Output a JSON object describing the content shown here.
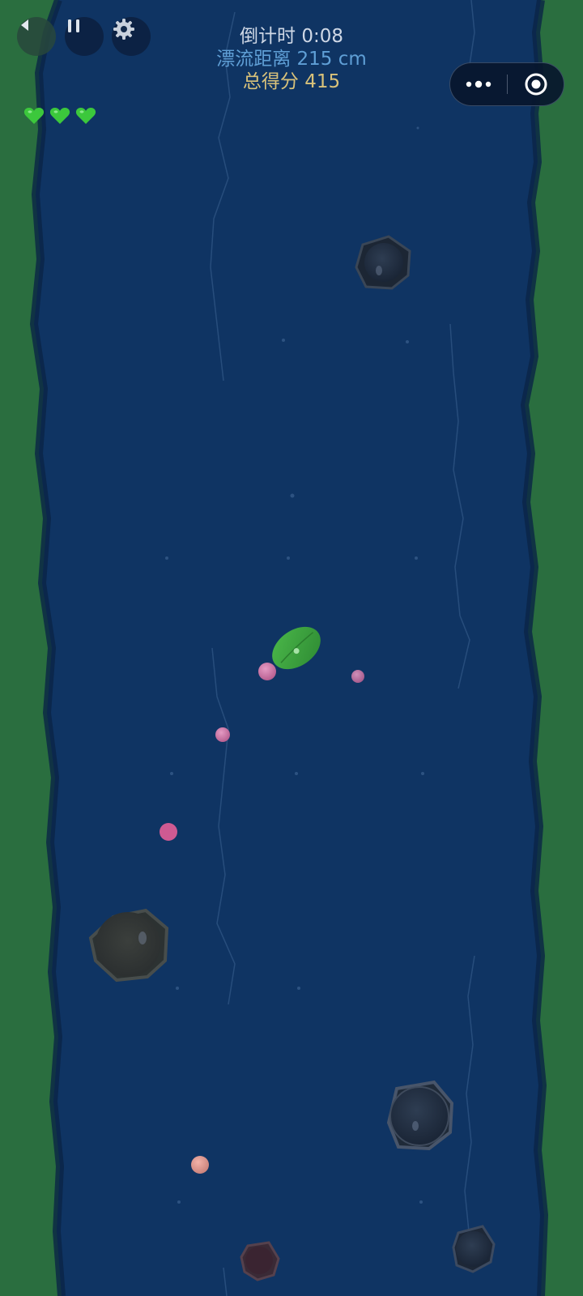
{
  "hud": {
    "timer_label": "倒计时",
    "timer_value": "0:08",
    "distance_label": "漂流距离",
    "distance_value": "215 cm",
    "score_label": "总得分",
    "score_value": "415"
  },
  "lives": {
    "count": 3,
    "icon": "heart-icon"
  },
  "controls": {
    "back": "back-arrow-icon",
    "pause": "pause-icon",
    "settings": "gear-icon",
    "more": "more-dots-icon",
    "close": "target-close-icon"
  },
  "colors": {
    "grass": "#2a6e3f",
    "river": "#0f3463",
    "leaf": "#3fa53f",
    "heart": "#3cc83c",
    "timer_text": "#cfd8e6",
    "distance_text": "#5f9fd6",
    "score_text": "#d9c27a"
  }
}
